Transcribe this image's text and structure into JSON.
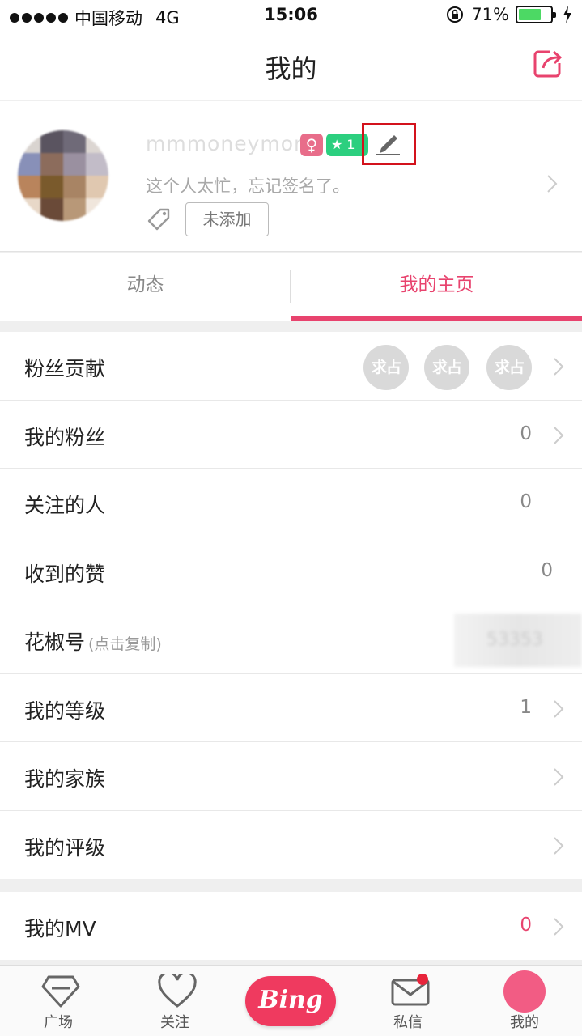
{
  "status_bar": {
    "carrier": "中国移动",
    "network": "4G",
    "time": "15:06",
    "battery_percent": "71%",
    "battery_level": 0.71,
    "battery_color": "#4cd964"
  },
  "nav": {
    "title": "我的",
    "share_icon": "share-icon"
  },
  "profile": {
    "username": "mmmoneymore",
    "gender_symbol": "♀",
    "level_text": "★ 1",
    "signature": "这个人太忙，忘记签名了。",
    "tag_button": "未添加",
    "edit_icon": "pencil-icon"
  },
  "tabs": [
    {
      "label": "动态"
    },
    {
      "label": "我的主页"
    }
  ],
  "rows": [
    {
      "label": "粉丝贡献",
      "badges": [
        "求占",
        "求占",
        "求占"
      ]
    },
    {
      "label": "我的粉丝",
      "value": "0"
    },
    {
      "label": "关注的人",
      "value": "0"
    },
    {
      "label": "收到的赞",
      "value": "0"
    },
    {
      "label": "花椒号",
      "hint": "(点击复制)",
      "value": "53353"
    },
    {
      "label": "我的等级",
      "value": "1"
    },
    {
      "label": "我的家族"
    },
    {
      "label": "我的评级"
    }
  ],
  "mv_row": {
    "label": "我的MV",
    "value": "0"
  },
  "tabbar": {
    "square": "广场",
    "follow": "关注",
    "center": "Bing",
    "messages": "私信",
    "me": "我的"
  },
  "colors": {
    "accent": "#e8436e",
    "highlight_box": "#d3121c"
  }
}
